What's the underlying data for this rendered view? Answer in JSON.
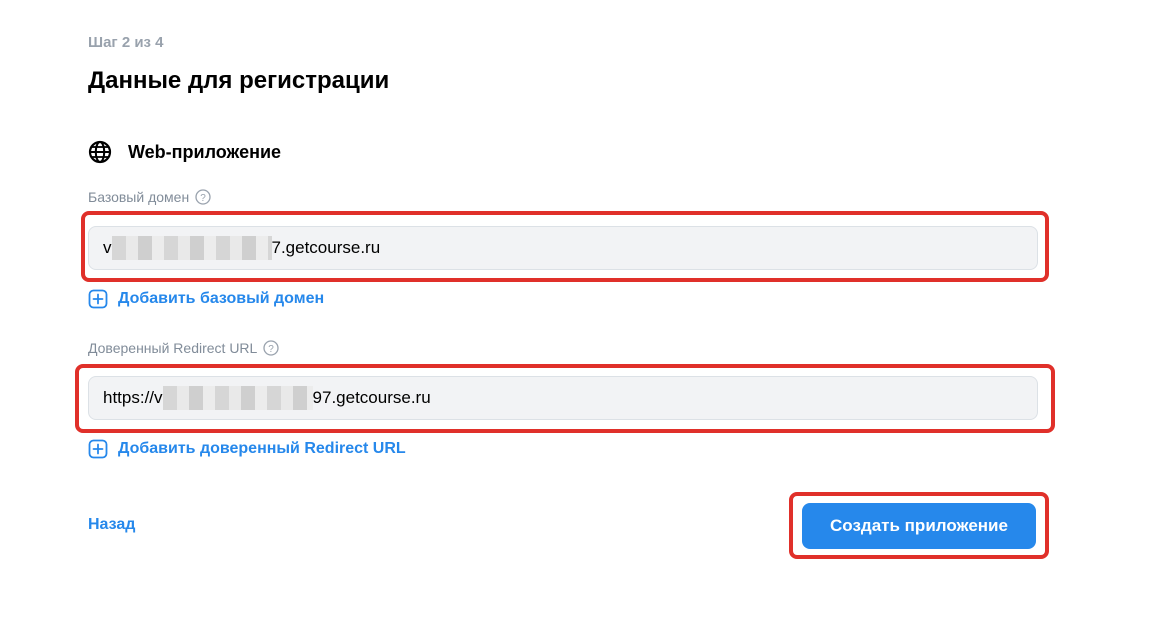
{
  "header": {
    "step": "Шаг 2 из 4",
    "title": "Данные для регистрации"
  },
  "platform": {
    "icon": "globe-icon",
    "label": "Web-приложение"
  },
  "base_domain": {
    "label": "Базовый домен",
    "value_prefix": "v",
    "value_suffix": "7.getcourse.ru",
    "add_label": "Добавить базовый домен"
  },
  "redirect_url": {
    "label": "Доверенный Redirect URL",
    "value_prefix": "https://v",
    "value_suffix": "97.getcourse.ru",
    "add_label": "Добавить доверенный Redirect URL"
  },
  "footer": {
    "back_label": "Назад",
    "create_label": "Создать приложение"
  },
  "colors": {
    "accent": "#2688eb",
    "highlight": "#e0302a",
    "input_bg": "#f2f3f5"
  }
}
